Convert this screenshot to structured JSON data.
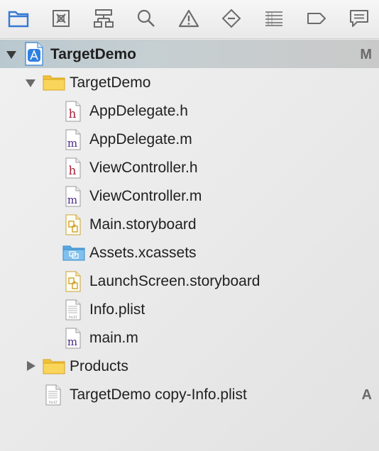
{
  "toolbar": {
    "buttons": [
      {
        "icon": "folder-icon",
        "selected": true
      },
      {
        "icon": "source-control-icon"
      },
      {
        "icon": "symbol-hierarchy-icon"
      },
      {
        "icon": "search-icon"
      },
      {
        "icon": "warning-icon"
      },
      {
        "icon": "test-diamond-icon"
      },
      {
        "icon": "debug-list-icon"
      },
      {
        "icon": "breakpoint-tag-icon"
      },
      {
        "icon": "report-bubble-icon"
      }
    ],
    "accent": "#3478d4"
  },
  "tree": {
    "project": {
      "label": "TargetDemo",
      "badge": "M"
    },
    "group": {
      "label": "TargetDemo"
    },
    "files": [
      {
        "label": "AppDelegate.h",
        "kind": "h"
      },
      {
        "label": "AppDelegate.m",
        "kind": "m"
      },
      {
        "label": "ViewController.h",
        "kind": "h"
      },
      {
        "label": "ViewController.m",
        "kind": "m"
      },
      {
        "label": "Main.storyboard",
        "kind": "storyboard"
      },
      {
        "label": "Assets.xcassets",
        "kind": "assets"
      },
      {
        "label": "LaunchScreen.storyboard",
        "kind": "storyboard"
      },
      {
        "label": "Info.plist",
        "kind": "plist"
      },
      {
        "label": "main.m",
        "kind": "m"
      }
    ],
    "products": {
      "label": "Products"
    },
    "extra": {
      "label": "TargetDemo copy-Info.plist",
      "badge": "A"
    },
    "letters": {
      "h": "h",
      "m": "m",
      "plist": "PLIST"
    }
  }
}
